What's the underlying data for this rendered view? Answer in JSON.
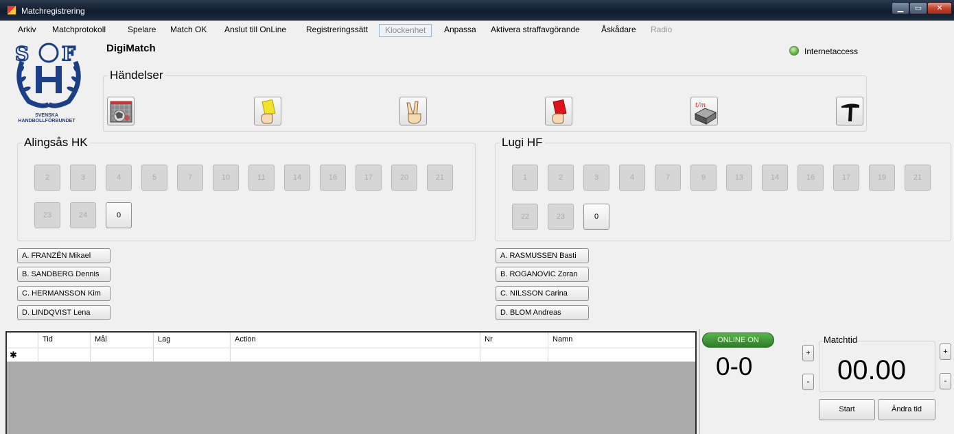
{
  "window": {
    "title": "Matchregistrering"
  },
  "menu": [
    {
      "label": "Arkiv",
      "enabled": true
    },
    {
      "label": "Matchprotokoll",
      "enabled": true
    },
    {
      "label": "Spelare",
      "enabled": true
    },
    {
      "label": "Match OK",
      "enabled": true
    },
    {
      "label": "Anslut till OnLine",
      "enabled": true
    },
    {
      "label": "Registreringssätt",
      "enabled": true
    },
    {
      "label": "Klockenhet",
      "enabled": false
    },
    {
      "label": "Anpassa",
      "enabled": true
    },
    {
      "label": "Aktivera straffavgörande",
      "enabled": true
    },
    {
      "label": "Åskådare",
      "enabled": true
    },
    {
      "label": "Radio",
      "enabled": false
    }
  ],
  "logo": {
    "line1": "SVENSKA",
    "line2": "HANDBOLLFÖRBUNDET"
  },
  "app_name": "DigiMatch",
  "internet": {
    "label": "Internetaccess",
    "status_color": "#5fb33e"
  },
  "events": {
    "title": "Händelser",
    "buttons": [
      "goal-icon",
      "yellow-card-icon",
      "two-minutes-icon",
      "red-card-icon",
      "timeout-icon",
      "stop-icon"
    ]
  },
  "home": {
    "name": "Alingsås HK",
    "players": [
      "2",
      "3",
      "4",
      "5",
      "7",
      "10",
      "11",
      "14",
      "16",
      "17",
      "20",
      "21",
      "23",
      "24",
      "0"
    ],
    "officials": [
      "A. FRANZÉN Mikael",
      "B. SANDBERG Dennis",
      "C. HERMANSSON Kim",
      "D. LINDQVIST Lena"
    ]
  },
  "away": {
    "name": "Lugi HF",
    "players": [
      "1",
      "2",
      "3",
      "4",
      "7",
      "9",
      "13",
      "14",
      "16",
      "17",
      "19",
      "21",
      "22",
      "23",
      "0"
    ],
    "officials": [
      "A. RASMUSSEN Basti",
      "B. ROGANOVIC Zoran",
      "C. NILSSON Carina",
      "D. BLOM Andreas"
    ]
  },
  "grid": {
    "columns": [
      "Tid",
      "Mål",
      "Lag",
      "Action",
      "Nr",
      "Namn"
    ],
    "new_row_marker": "✱"
  },
  "online": {
    "label": "ONLINE ON"
  },
  "score": "0-0",
  "matchtid": {
    "label": "Matchtid",
    "value": "00.00"
  },
  "controls": {
    "plus": "+",
    "minus": "-",
    "start": "Start",
    "change_time": "Ändra tid"
  }
}
